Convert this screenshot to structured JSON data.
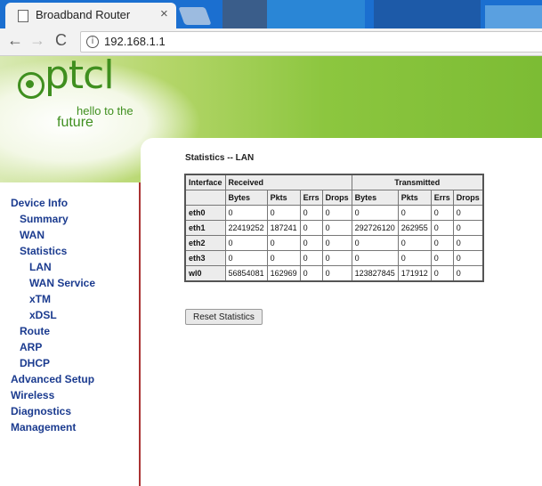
{
  "browser": {
    "tab_title": "Broadband Router",
    "tab_close": "×",
    "back": "←",
    "forward": "→",
    "reload": "C",
    "info": "i",
    "url": "192.168.1.1"
  },
  "logo": {
    "word": "ptcl",
    "tagline_1": "hello to the",
    "tagline_2": "future",
    "color": "#3f8f1f"
  },
  "nav": {
    "device_info": "Device Info",
    "summary": "Summary",
    "wan": "WAN",
    "statistics": "Statistics",
    "lan": "LAN",
    "wan_service": "WAN Service",
    "xtm": "xTM",
    "xdsl": "xDSL",
    "route": "Route",
    "arp": "ARP",
    "dhcp": "DHCP",
    "advanced_setup": "Advanced Setup",
    "wireless": "Wireless",
    "diagnostics": "Diagnostics",
    "management": "Management"
  },
  "content": {
    "heading": "Statistics -- LAN",
    "table": {
      "interface_header": "Interface",
      "received_header": "Received",
      "transmitted_header": "Transmitted",
      "sub_headers": [
        "Bytes",
        "Pkts",
        "Errs",
        "Drops",
        "Bytes",
        "Pkts",
        "Errs",
        "Drops"
      ],
      "rows": [
        [
          "eth0",
          "0",
          "0",
          "0",
          "0",
          "0",
          "0",
          "0",
          "0"
        ],
        [
          "eth1",
          "22419252",
          "187241",
          "0",
          "0",
          "292726120",
          "262955",
          "0",
          "0"
        ],
        [
          "eth2",
          "0",
          "0",
          "0",
          "0",
          "0",
          "0",
          "0",
          "0"
        ],
        [
          "eth3",
          "0",
          "0",
          "0",
          "0",
          "0",
          "0",
          "0",
          "0"
        ],
        [
          "wl0",
          "56854081",
          "162969",
          "0",
          "0",
          "123827845",
          "171912",
          "0",
          "0"
        ]
      ]
    },
    "reset_button": "Reset Statistics"
  },
  "colors": {
    "nav_text": "#1b3b8f",
    "sidebar_border": "#a33",
    "banner_green": "#8cc63f"
  }
}
